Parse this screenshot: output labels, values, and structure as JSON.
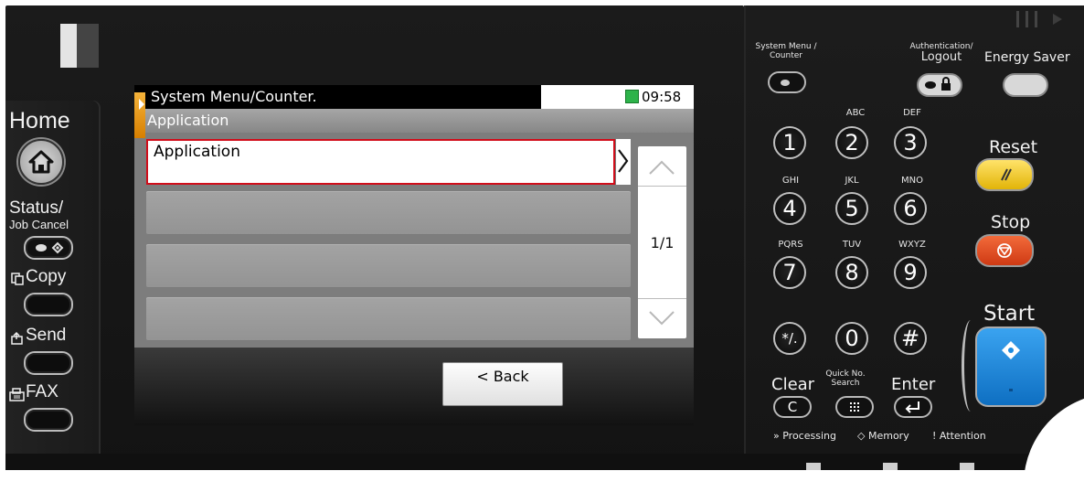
{
  "left_keys": {
    "home": "Home",
    "status_line1": "Status/",
    "status_line2": "Job Cancel",
    "copy": "Copy",
    "send": "Send",
    "fax": "FAX"
  },
  "screen": {
    "title": "System Menu/Counter.",
    "clock": "09:58",
    "subtitle": "Application",
    "rows": [
      "Application",
      "",
      "",
      ""
    ],
    "page_indicator": "1/1",
    "back_label": "< Back"
  },
  "right_keys": {
    "system_menu_line1": "System Menu /",
    "system_menu_line2": "Counter",
    "auth_line1": "Authentication/",
    "auth_line2": "Logout",
    "energy_saver": "Energy Saver",
    "reset": "Reset",
    "stop": "Stop",
    "start": "Start",
    "clear": "Clear",
    "quick_line1": "Quick No.",
    "quick_line2": "Search",
    "enter": "Enter",
    "keys": [
      {
        "digit": "1",
        "letters": ""
      },
      {
        "digit": "2",
        "letters": "ABC"
      },
      {
        "digit": "3",
        "letters": "DEF"
      },
      {
        "digit": "4",
        "letters": "GHI"
      },
      {
        "digit": "5",
        "letters": "JKL"
      },
      {
        "digit": "6",
        "letters": "MNO"
      },
      {
        "digit": "7",
        "letters": "PQRS"
      },
      {
        "digit": "8",
        "letters": "TUV"
      },
      {
        "digit": "9",
        "letters": "WXYZ"
      },
      {
        "digit": "*/.",
        "letters": ""
      },
      {
        "digit": "0",
        "letters": ""
      },
      {
        "digit": "#",
        "letters": ""
      }
    ],
    "status_processing": "Processing",
    "status_memory": "Memory",
    "status_attention": "Attention"
  },
  "colors": {
    "reset_key": "#f0c419",
    "stop_key": "#e0481e",
    "start_key": "#1d8be0",
    "selection_border": "#d10d1a",
    "title_tab": "#f0a02a",
    "clock_icon": "#2db34a"
  }
}
